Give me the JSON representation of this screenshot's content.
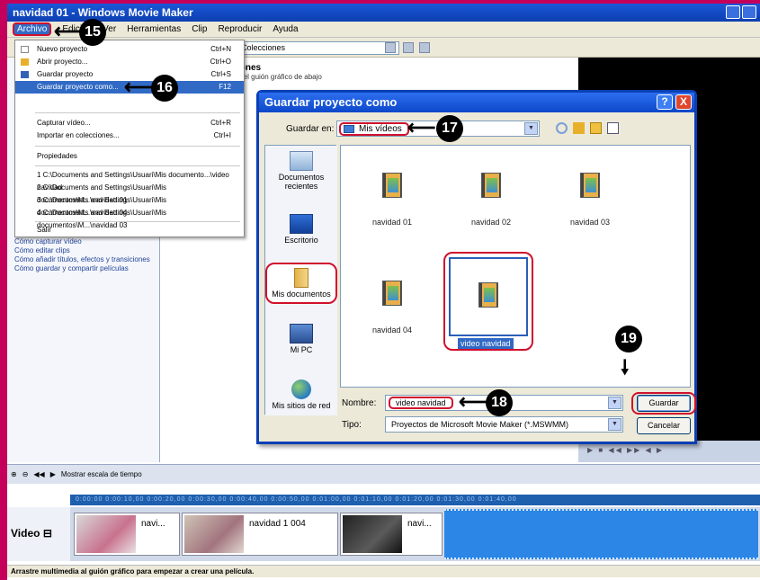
{
  "window": {
    "title": "navidad 01 - Windows Movie Maker"
  },
  "menubar": {
    "items": [
      "Archivo",
      "Edición",
      "Ver",
      "Herramientas",
      "Clip",
      "Reproducir",
      "Ayuda"
    ]
  },
  "toolbar": {
    "collections_label": "Colecciones"
  },
  "dropdown": {
    "items": [
      {
        "label": "Nuevo proyecto",
        "shortcut": "Ctrl+N"
      },
      {
        "label": "Abrir proyecto...",
        "shortcut": "Ctrl+O"
      },
      {
        "label": "Guardar proyecto",
        "shortcut": "Ctrl+S"
      },
      {
        "label": "Guardar proyecto como...",
        "shortcut": "F12"
      },
      {
        "label": "Capturar vídeo...",
        "shortcut": "Ctrl+R"
      },
      {
        "label": "Importar en colecciones...",
        "shortcut": "Ctrl+I"
      },
      {
        "label": "Propiedades",
        "shortcut": ""
      },
      {
        "label": "1 C:\\Documents and Settings\\Usuari\\Mis documento...\\video navidad",
        "shortcut": ""
      },
      {
        "label": "2 C:\\Documents and Settings\\Usuari\\Mis documentos\\M...\\navidad 01",
        "shortcut": ""
      },
      {
        "label": "3 C:\\Documents and Settings\\Usuari\\Mis documentos\\M...\\navidad 04",
        "shortcut": ""
      },
      {
        "label": "4 C:\\Documents and Settings\\Usuari\\Mis documentos\\M...\\navidad 03",
        "shortcut": ""
      },
      {
        "label": "Salir",
        "shortcut": ""
      }
    ]
  },
  "main": {
    "heading": "iones",
    "subtext": "n el guión gráfico de abajo",
    "tasks": [
      "Cómo capturar vídeo",
      "Cómo editar clips",
      "Cómo añadir títulos, efectos y transiciones",
      "Cómo guardar y compartir películas"
    ]
  },
  "dialog": {
    "title": "Guardar proyecto como",
    "help": "?",
    "close": "X",
    "save_in_label": "Guardar en:",
    "save_in_value": "Mis vídeos",
    "places": [
      "Documentos recientes",
      "Escritorio",
      "Mis documentos",
      "Mi PC",
      "Mis sitios de red"
    ],
    "files": [
      "navidad 01",
      "navidad 02",
      "navidad 03",
      "navidad 04",
      "video navidad"
    ],
    "name_label": "Nombre:",
    "name_value": "video navidad",
    "type_label": "Tipo:",
    "type_value": "Proyectos de Microsoft Movie Maker (*.MSWMM)",
    "save_button": "Guardar",
    "cancel_button": "Cancelar"
  },
  "timeline": {
    "show_label": "Mostrar escala de tiempo",
    "ruler": "0:00:00   0:00:10,00   0:00:20,00   0:00:30,00   0:00:40,00   0:00:50,00   0:01:00,00   0:01:10,00   0:01:20,00   0:01:30,00   0:01:40,00",
    "track_label": "Video",
    "clips": [
      "navi...",
      "navidad 1 004",
      "navi..."
    ]
  },
  "status": {
    "text": "Arrastre multimedia al guión gráfico para empezar a crear una película."
  },
  "callouts": [
    "15",
    "16",
    "17",
    "18",
    "19"
  ],
  "colors": {
    "frame": "#c4005a",
    "highlight_border": "#d0102c",
    "titlebar": "#0b47c9",
    "selection": "#316ac5"
  }
}
